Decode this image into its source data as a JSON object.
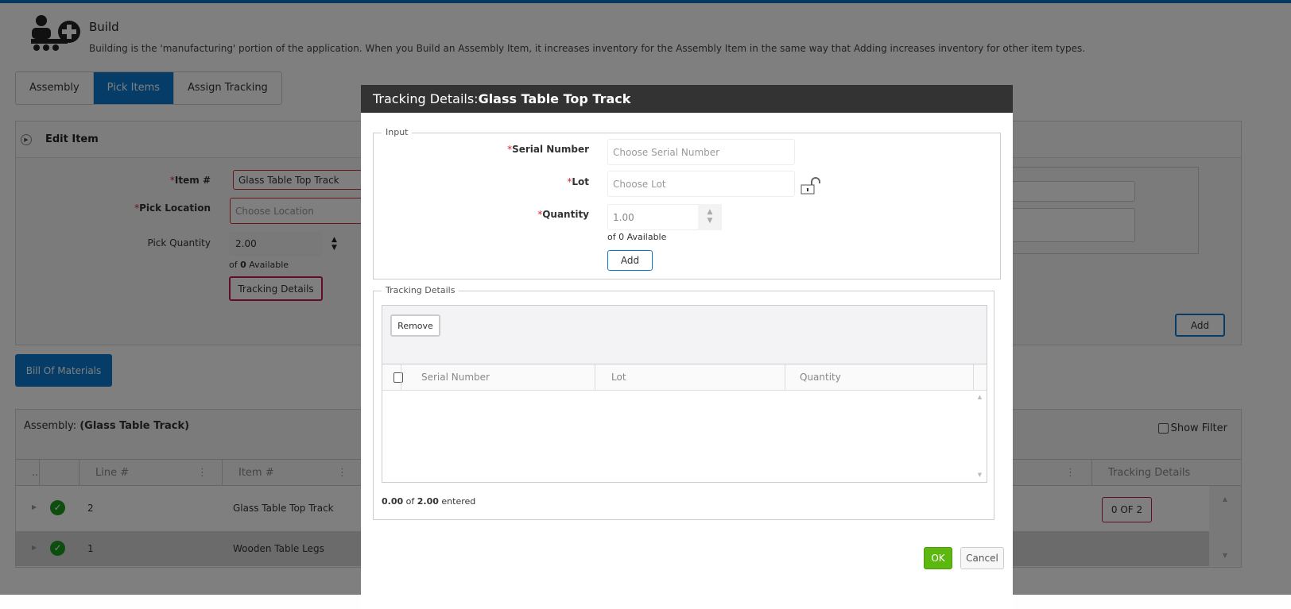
{
  "header": {
    "title": "Build",
    "description": "Building is the 'manufacturing' portion of the application. When you Build an Assembly Item, it increases inventory for the Assembly Item in the same way that Adding increases inventory for other item types.",
    "icon": "build-assembly-icon"
  },
  "tabs": [
    {
      "label": "Assembly"
    },
    {
      "label": "Pick Items",
      "active": true
    },
    {
      "label": "Assign Tracking"
    }
  ],
  "edit_item": {
    "title": "Edit Item",
    "item_label": "Item #",
    "item_value": "Glass Table Top Track",
    "location_label": "Pick Location",
    "location_placeholder": "Choose Location",
    "qty_label": "Pick Quantity",
    "qty_value": "2.00",
    "avail_prefix": "of",
    "avail_count": "0",
    "avail_suffix": "Available",
    "tracking_button": "Tracking Details",
    "add_button": "Add"
  },
  "bom_button": "Bill Of Materials",
  "grid": {
    "assembly_label": "Assembly:",
    "assembly_name": "(Glass Table Track)",
    "show_filter": "Show Filter",
    "columns": {
      "dots": "..",
      "line": "Line #",
      "item": "Item #",
      "tracking": "Tracking Details"
    },
    "rows": [
      {
        "line": "2",
        "item": "Glass Table Top Track",
        "tracking": "0 OF 2",
        "status": "complete"
      },
      {
        "line": "1",
        "item": "Wooden Table Legs",
        "tracking": "",
        "status": "complete"
      }
    ]
  },
  "modal": {
    "title_prefix": "Tracking Details:",
    "title_item": "Glass Table Top Track",
    "input_legend": "Input",
    "serial_label": "Serial Number",
    "serial_placeholder": "Choose Serial Number",
    "lot_label": "Lot",
    "lot_placeholder": "Choose Lot",
    "qty_label": "Quantity",
    "qty_value": "1.00",
    "avail_text": "of 0 Available",
    "add_button": "Add",
    "details_legend": "Tracking Details",
    "remove_button": "Remove",
    "columns": {
      "serial": "Serial Number",
      "lot": "Lot",
      "quantity": "Quantity"
    },
    "entered_value": "0.00",
    "entered_of": "of",
    "entered_total": "2.00",
    "entered_suffix": "entered",
    "ok_button": "OK",
    "cancel_button": "Cancel"
  },
  "colors": {
    "primary": "#0a7ad0",
    "ok": "#5cb80f",
    "required": "#d9232e",
    "highlight_border": "#c2185b",
    "check": "#1a9a1a"
  }
}
